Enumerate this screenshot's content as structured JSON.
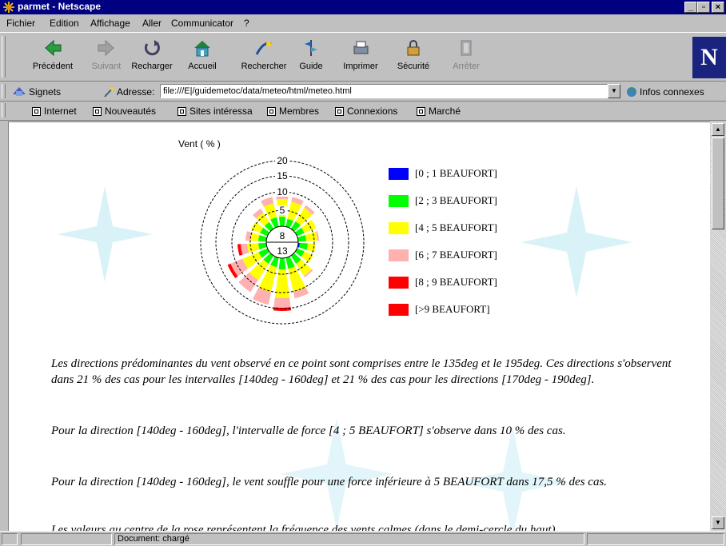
{
  "window": {
    "title": "parmet - Netscape"
  },
  "menu": [
    "Fichier",
    "Edition",
    "Affichage",
    "Aller",
    "Communicator",
    "?"
  ],
  "toolbar": [
    {
      "label": "Précédent",
      "icon": "back-arrow-icon",
      "enabled": true
    },
    {
      "label": "Suivant",
      "icon": "forward-arrow-icon",
      "enabled": false
    },
    {
      "label": "Recharger",
      "icon": "reload-icon",
      "enabled": true
    },
    {
      "label": "Accueil",
      "icon": "home-icon",
      "enabled": true
    },
    {
      "label": "Rechercher",
      "icon": "search-icon",
      "enabled": true
    },
    {
      "label": "Guide",
      "icon": "guide-icon",
      "enabled": true
    },
    {
      "label": "Imprimer",
      "icon": "printer-icon",
      "enabled": true
    },
    {
      "label": "Sécurité",
      "icon": "lock-icon",
      "enabled": true
    },
    {
      "label": "Arrêter",
      "icon": "stop-icon",
      "enabled": false
    }
  ],
  "location": {
    "bookmarks_label": "Signets",
    "address_label": "Adresse:",
    "url": "file:///E|/guidemetoc/data/meteo/html/meteo.html",
    "related_label": "Infos connexes"
  },
  "personal_toolbar": [
    "Internet",
    "Nouveautés",
    "Sites intéressa",
    "Membres",
    "Connexions",
    "Marché"
  ],
  "wind_rose": {
    "title": "Vent ( % )",
    "ring_labels": [
      "5",
      "10",
      "15",
      "20"
    ],
    "calm_upper": "8",
    "calm_lower": "13",
    "legend": [
      {
        "label": "[0 ; 1 BEAUFORT]",
        "color": "#0000ff"
      },
      {
        "label": "[2 ; 3 BEAUFORT]",
        "color": "#00ff00"
      },
      {
        "label": "[4 ; 5 BEAUFORT]",
        "color": "#ffff00"
      },
      {
        "label": "[6 ; 7 BEAUFORT]",
        "color": "#ffb0b0"
      },
      {
        "label": "[8 ; 9 BEAUFORT]",
        "color": "#ff0000"
      },
      {
        "label": "[>9 BEAUFORT]",
        "color": "#ff0000"
      }
    ]
  },
  "paragraphs": [
    "Les directions prédominantes du vent observé en ce point sont comprises entre le 135deg  et le 195deg. Ces directions s'observent dans 21 % des cas pour les intervalles [140deg - 160deg] et 21 % des cas pour les directions [170deg - 190deg].",
    "Pour la direction [140deg - 160deg], l'intervalle de force [4 ; 5 BEAUFORT] s'observe dans 10 % des cas.",
    "Pour la direction [140deg - 160deg], le vent souffle pour une force inférieure à 5 BEAUFORT dans 17,5 % des cas.",
    "Les valeurs au centre de la rose représentent la fréquence des vents calmes (dans le demi-cercle du haut)"
  ],
  "status": {
    "text": "Document: chargé"
  }
}
